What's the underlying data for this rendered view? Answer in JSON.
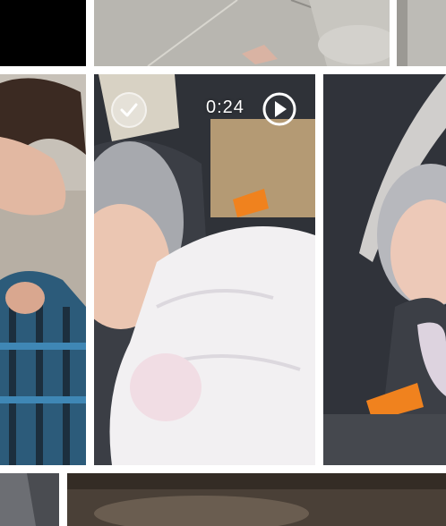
{
  "gallery": {
    "tiles": [
      {
        "id": "r1c1",
        "kind": "photo",
        "icon": "photo-thumbnail"
      },
      {
        "id": "r1c2",
        "kind": "photo",
        "icon": "photo-thumbnail"
      },
      {
        "id": "r1c3",
        "kind": "photo",
        "icon": "photo-thumbnail"
      },
      {
        "id": "r2c1",
        "kind": "photo",
        "icon": "photo-thumbnail"
      },
      {
        "id": "r2c2",
        "kind": "video",
        "duration": "0:24",
        "select_icon": "check-icon",
        "play_icon": "play-icon"
      },
      {
        "id": "r2c3",
        "kind": "photo",
        "icon": "photo-thumbnail"
      },
      {
        "id": "r3c1",
        "kind": "photo",
        "icon": "photo-thumbnail"
      },
      {
        "id": "r3c2",
        "kind": "photo",
        "icon": "photo-thumbnail"
      }
    ],
    "video": {
      "duration": "0:24"
    }
  },
  "colors": {
    "background": "#ffffff",
    "overlay_text": "#ffffff"
  }
}
